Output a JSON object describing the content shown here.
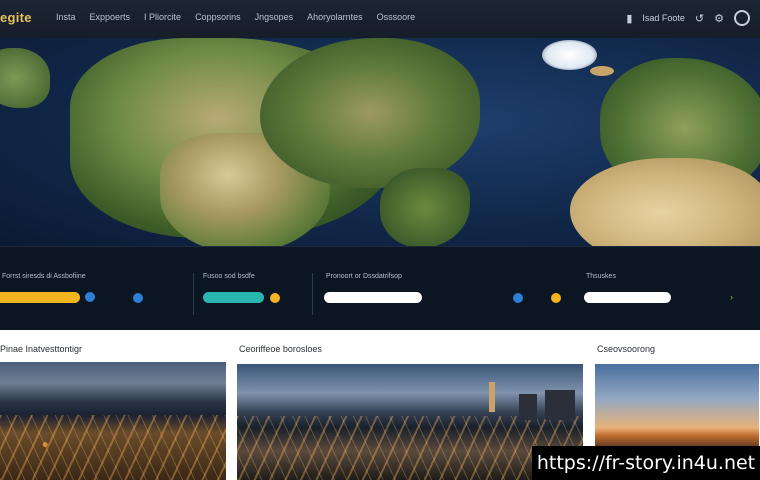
{
  "header": {
    "logo": "egite",
    "nav": [
      "Insta",
      "Exppoerts",
      "I Pliorcite",
      "Coppsorins",
      "Jngsopes",
      "Ahoryolarntes",
      "Osssoore"
    ],
    "right_text": "Isad Foote"
  },
  "dashboard": {
    "panels": [
      {
        "label": "Forrst siresds di Assbofiine",
        "bar_color": "#f2b51f"
      },
      {
        "label": "Fusoo sod bsdfe",
        "bar_color": "#29b6b0"
      },
      {
        "label": "Pronoort or Dssdatrifsop",
        "bar_color": "#ffffff"
      },
      {
        "label": "Thsuskes",
        "bar_color": "#ffffff"
      }
    ],
    "colors": {
      "blue_dot": "#2e7fd9",
      "yellow_dot": "#f2b51f",
      "green_chevron": "#7fbf3a"
    }
  },
  "cards": [
    {
      "title": "Pinae Inatvesttontigr"
    },
    {
      "title": "Ceoriffeoe borosloes"
    },
    {
      "title": "Cseovsoorong"
    }
  ],
  "watermark": "https://fr-story.in4u.net"
}
